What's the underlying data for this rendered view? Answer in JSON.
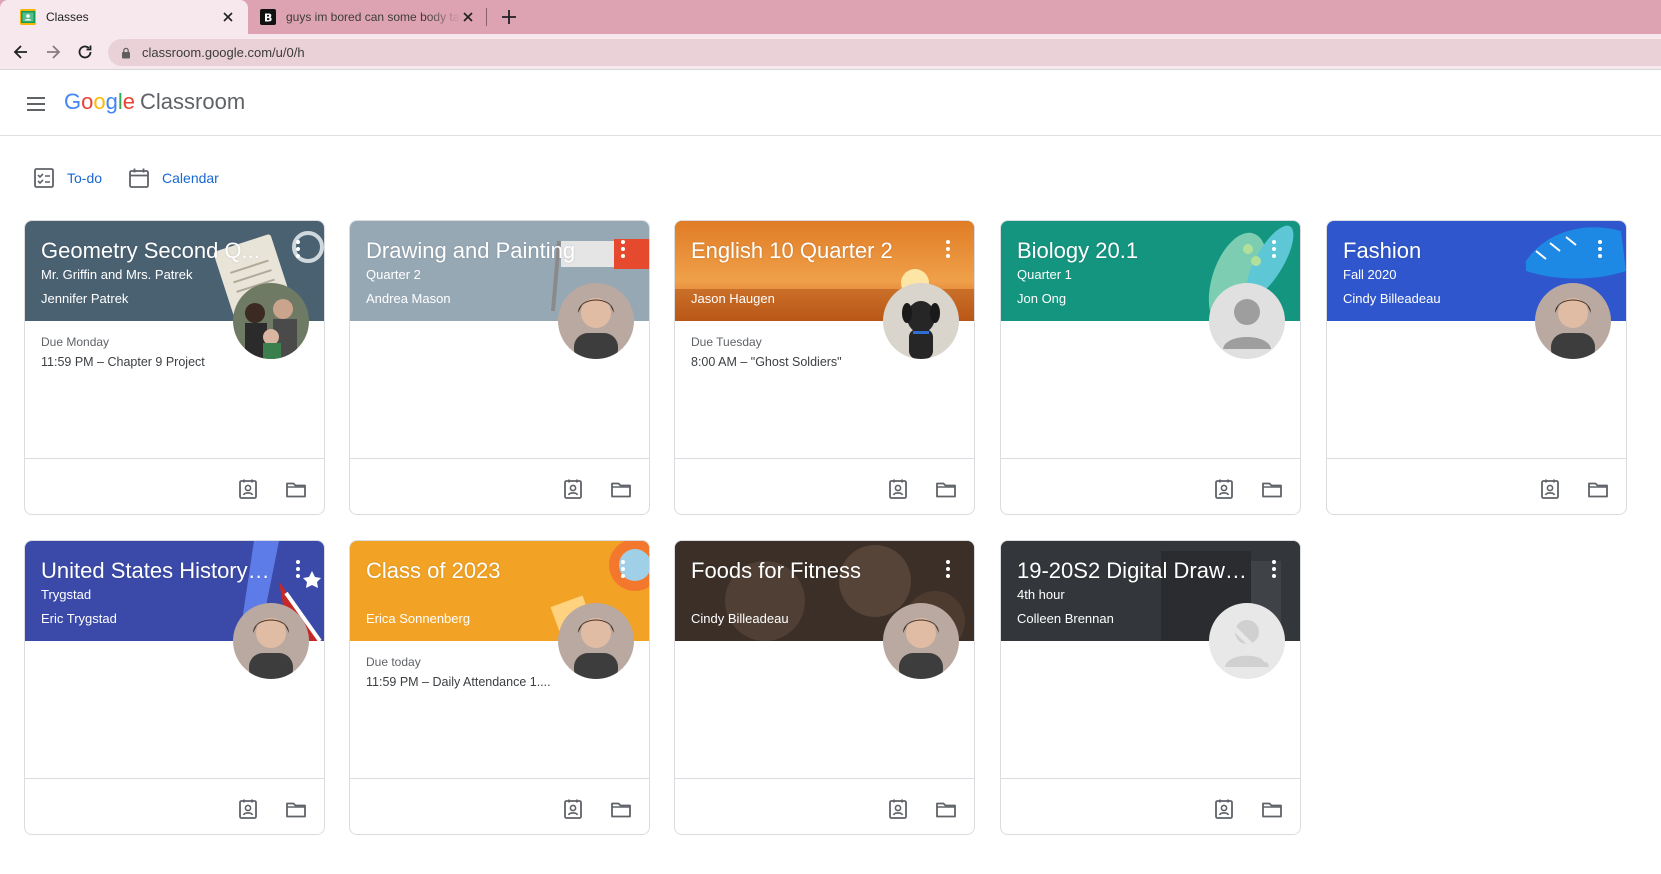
{
  "browser": {
    "tabs": [
      {
        "title": "Classes",
        "active": true,
        "favicon": "classroom-icon"
      },
      {
        "title": "guys im bored can some body talk to me",
        "active": false,
        "favicon": "brainly-icon"
      }
    ],
    "url": "classroom.google.com/u/0/h"
  },
  "app": {
    "brand_google": "Google",
    "brand_product": "Classroom"
  },
  "subnav": {
    "todo_label": "To-do",
    "calendar_label": "Calendar"
  },
  "classes": [
    {
      "title": "Geometry Second Q...",
      "section": "Mr. Griffin and Mrs. Patrek",
      "teacher": "Jennifer Patrek",
      "due_label": "Due Monday",
      "due_detail": "11:59 PM – Chapter 9 Project",
      "color": "#4a6172",
      "avatar": "group-photo"
    },
    {
      "title": "Drawing and Painting",
      "section": "Quarter 2",
      "teacher": "Andrea Mason",
      "due_label": "",
      "due_detail": "",
      "color": "#97a8b5",
      "avatar": "person-photo"
    },
    {
      "title": "English 10 Quarter 2",
      "section": "",
      "teacher": "Jason Haugen",
      "due_label": "Due Tuesday",
      "due_detail": "8:00 AM – \"Ghost Soldiers\"",
      "color": "#d9772a",
      "avatar": "dog-photo"
    },
    {
      "title": "Biology 20.1",
      "section": "Quarter 1",
      "teacher": "Jon Ong",
      "due_label": "",
      "due_detail": "",
      "color": "#14957f",
      "avatar": "default-person"
    },
    {
      "title": "Fashion",
      "section": "Fall 2020",
      "teacher": "Cindy Billeadeau",
      "due_label": "",
      "due_detail": "",
      "color": "#2f56cc",
      "avatar": "person-photo"
    },
    {
      "title": "United States History ...",
      "section": "Trygstad",
      "teacher": "Eric Trygstad",
      "due_label": "",
      "due_detail": "",
      "color": "#3b4aa8",
      "avatar": "person-photo"
    },
    {
      "title": "Class of 2023",
      "section": "",
      "teacher": "Erica Sonnenberg",
      "due_label": "Due today",
      "due_detail": "11:59 PM – Daily Attendance 1....",
      "color": "#f2a325",
      "avatar": "person-photo"
    },
    {
      "title": "Foods for Fitness",
      "section": "",
      "teacher": "Cindy Billeadeau",
      "due_label": "",
      "due_detail": "",
      "color": "#4a3c34",
      "avatar": "person-photo"
    },
    {
      "title": "19-20S2 Digital Drawi...",
      "section": "4th hour",
      "teacher": "Colleen Brennan",
      "due_label": "",
      "due_detail": "",
      "color": "#3a3d40",
      "avatar": "no-person"
    }
  ]
}
